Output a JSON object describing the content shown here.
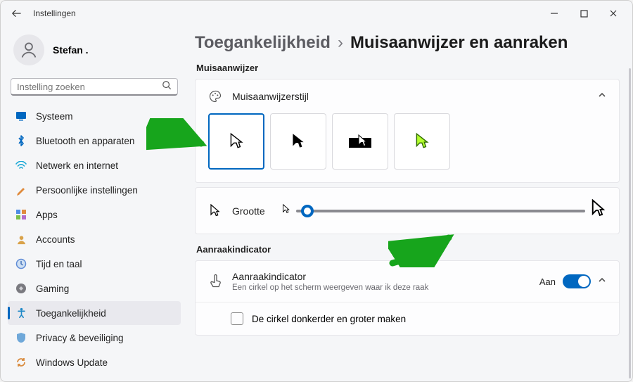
{
  "titlebar": {
    "app_title": "Instellingen"
  },
  "user": {
    "name": "Stefan ."
  },
  "search": {
    "placeholder": "Instelling zoeken"
  },
  "sidebar": {
    "items": [
      {
        "label": "Systeem",
        "icon": "system"
      },
      {
        "label": "Bluetooth en apparaten",
        "icon": "bluetooth"
      },
      {
        "label": "Netwerk en internet",
        "icon": "network"
      },
      {
        "label": "Persoonlijke instellingen",
        "icon": "personalize"
      },
      {
        "label": "Apps",
        "icon": "apps"
      },
      {
        "label": "Accounts",
        "icon": "accounts"
      },
      {
        "label": "Tijd en taal",
        "icon": "time"
      },
      {
        "label": "Gaming",
        "icon": "gaming"
      },
      {
        "label": "Toegankelijkheid",
        "icon": "accessibility",
        "active": true
      },
      {
        "label": "Privacy & beveiliging",
        "icon": "privacy"
      },
      {
        "label": "Windows Update",
        "icon": "update"
      }
    ]
  },
  "breadcrumb": {
    "parent": "Toegankelijkheid",
    "separator": "›",
    "current": "Muisaanwijzer en aanraken"
  },
  "sections": {
    "pointer": {
      "title": "Muisaanwijzer",
      "style_row": "Muisaanwijzerstijl",
      "size_row": "Grootte"
    },
    "touch": {
      "title": "Aanraakindicator",
      "row_title": "Aanraakindicator",
      "row_sub": "Een cirkel op het scherm weergeven waar ik deze raak",
      "toggle_label": "Aan",
      "checkbox_label": "De cirkel donkerder en groter maken"
    }
  },
  "colors": {
    "accent": "#0067c0"
  }
}
